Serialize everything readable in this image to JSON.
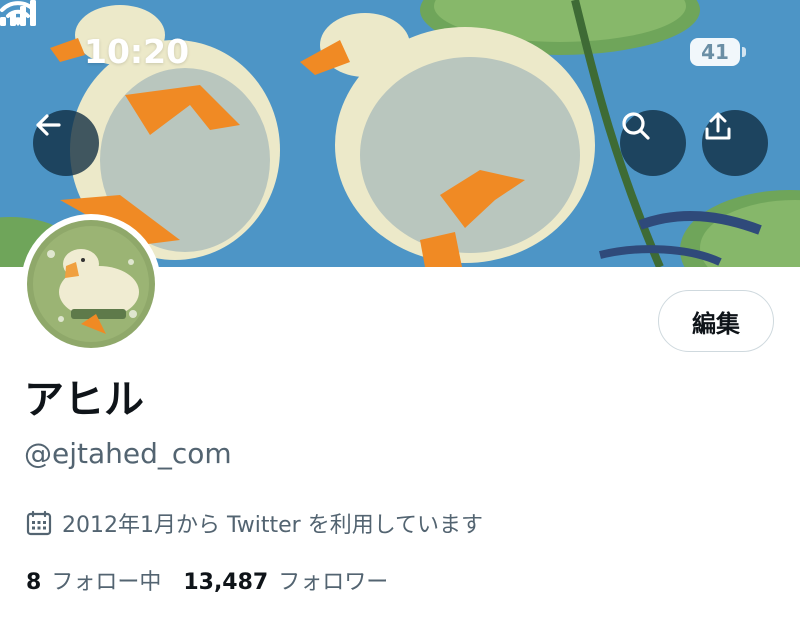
{
  "status_bar": {
    "time": "10:20",
    "battery_level": "41",
    "icons": [
      "signal-icon",
      "wifi-icon",
      "battery-icon"
    ]
  },
  "header": {
    "icons": [
      "arrow-left-icon",
      "search-icon",
      "share-icon"
    ]
  },
  "profile": {
    "edit_label": "編集",
    "display_name": "アヒル",
    "handle": "@ejtahed_com",
    "joined_text": "2012年1月から Twitter を利用しています",
    "joined_icon": "calendar-icon",
    "following_count": "8",
    "following_label": "フォロー中",
    "followers_count": "13,487",
    "followers_label": "フォロワー"
  },
  "colors": {
    "banner_sky": "#4d95c6",
    "primary_text": "#0f1419",
    "secondary_text": "#536471",
    "button_border": "#cfd9de"
  }
}
